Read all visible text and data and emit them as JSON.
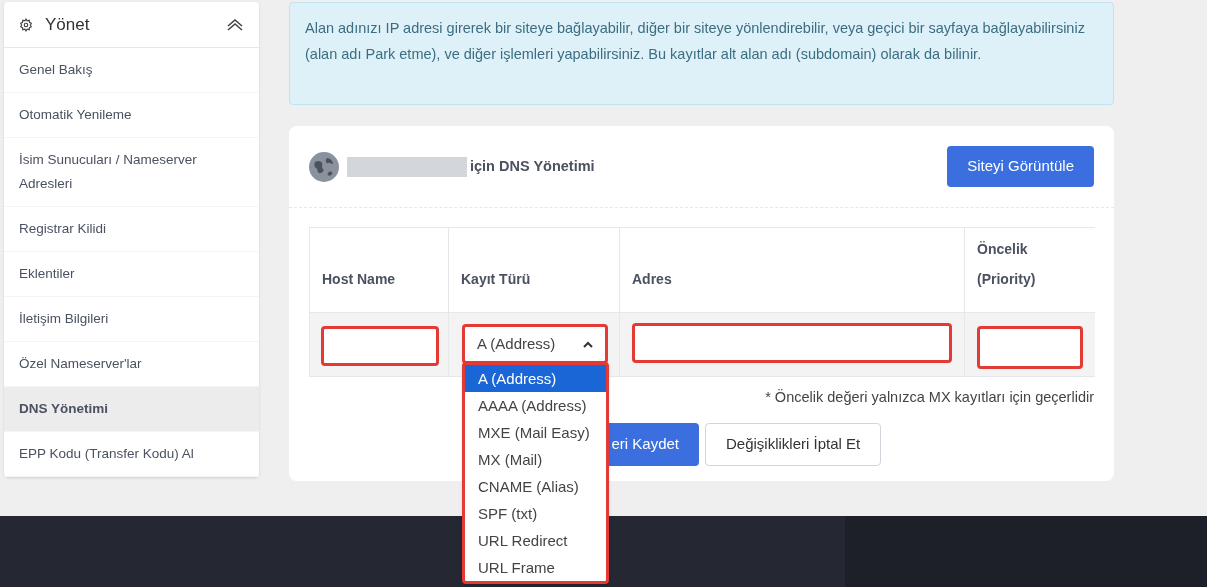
{
  "sidebar": {
    "title": "Yönet",
    "expanded": true,
    "items": [
      {
        "label": "Genel Bakış",
        "selected": false
      },
      {
        "label": "Otomatik Yenileme",
        "selected": false
      },
      {
        "label": "İsim Sunucuları / Nameserver Adresleri",
        "selected": false
      },
      {
        "label": "Registrar Kilidi",
        "selected": false
      },
      {
        "label": "Eklentiler",
        "selected": false
      },
      {
        "label": "İletişim Bilgileri",
        "selected": false
      },
      {
        "label": "Özel Nameserver'lar",
        "selected": false
      },
      {
        "label": "DNS Yönetimi",
        "selected": true
      },
      {
        "label": "EPP Kodu (Transfer Kodu) Al",
        "selected": false
      }
    ]
  },
  "info": "Alan adınızı IP adresi girerek bir siteye bağlayabilir, diğer bir siteye yönlendirebilir, veya geçici bir sayfaya bağlayabilirsiniz (alan adı Park etme), ve diğer işlemleri yapabilirsiniz. Bu kayıtlar alt alan adı (subdomain) olarak da bilinir.",
  "card": {
    "title": "için DNS Yönetimi",
    "view_button": "Siteyi Görüntüle",
    "table": {
      "columns": [
        "Host Name",
        "Kayıt Türü",
        "Adres",
        "Öncelik (Priority)"
      ],
      "row": {
        "host": {
          "highlighted": true
        },
        "type": {
          "value": "A (Address)",
          "highlighted": true,
          "expanded": true
        },
        "address": {
          "highlighted": true
        },
        "priority": {
          "highlighted": true
        }
      }
    },
    "type_options": [
      {
        "label": "A (Address)",
        "selected": true
      },
      {
        "label": "AAAA (Address)",
        "selected": false
      },
      {
        "label": "MXE (Mail Easy)",
        "selected": false
      },
      {
        "label": "MX (Mail)",
        "selected": false
      },
      {
        "label": "CNAME (Alias)",
        "selected": false
      },
      {
        "label": "SPF (txt)",
        "selected": false
      },
      {
        "label": "URL Redirect",
        "selected": false
      },
      {
        "label": "URL Frame",
        "selected": false
      }
    ],
    "note": "* Öncelik değeri yalnızca MX kayıtları için geçerlidir",
    "save_button": "eri Kaydet",
    "cancel_button": "Değişiklikleri İptal Et"
  }
}
